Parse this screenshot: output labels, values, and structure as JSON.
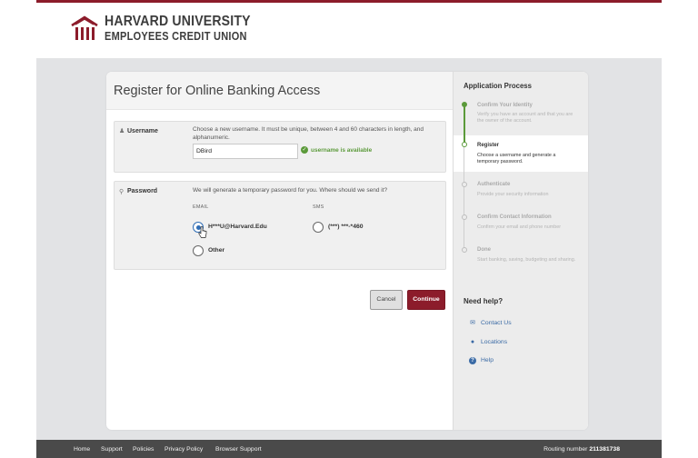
{
  "brand": {
    "line1": "HARVARD UNIVERSITY",
    "line2": "EMPLOYEES CREDIT UNION",
    "color": "#8c1c2b"
  },
  "form": {
    "title": "Register for Online Banking Access",
    "username": {
      "label": "Username",
      "icon": "user-icon",
      "hint": "Choose a new username. It must be unique, between 4 and 60 characters in length, and alphanumeric.",
      "value": "DBird",
      "status": "username is available"
    },
    "password": {
      "label": "Password",
      "icon": "key-icon",
      "hint": "We will generate a temporary password for you. Where should we send it?",
      "email_heading": "EMAIL",
      "sms_heading": "SMS",
      "email_option": "H***U@Harvard.Edu",
      "sms_option": "(***) ***-*460",
      "other_option": "Other",
      "selected": "email"
    },
    "cancel_label": "Cancel",
    "continue_label": "Continue"
  },
  "sidebar": {
    "title": "Application Process",
    "steps": [
      {
        "title": "Confirm Your Identity",
        "desc": "Verify you have an account and that you are the owner of the account.",
        "state": "done"
      },
      {
        "title": "Register",
        "desc": "Choose a username and generate a temporary password.",
        "state": "current"
      },
      {
        "title": "Authenticate",
        "desc": "Provide your security information",
        "state": "todo"
      },
      {
        "title": "Confirm Contact Information",
        "desc": "Confirm your email and phone number",
        "state": "todo"
      },
      {
        "title": "Done",
        "desc": "Start banking, saving, budgeting and sharing.",
        "state": "todo"
      }
    ],
    "help_title": "Need help?",
    "help_links": [
      {
        "label": "Contact Us",
        "icon": "envelope-icon"
      },
      {
        "label": "Locations",
        "icon": "map-pin-icon"
      },
      {
        "label": "Help",
        "icon": "question-icon"
      }
    ]
  },
  "footer": {
    "links": [
      "Home",
      "Support",
      "Policies",
      "Privacy Policy",
      "Browser Support"
    ],
    "routing_label": "Routing number",
    "routing_number": "211381738"
  }
}
